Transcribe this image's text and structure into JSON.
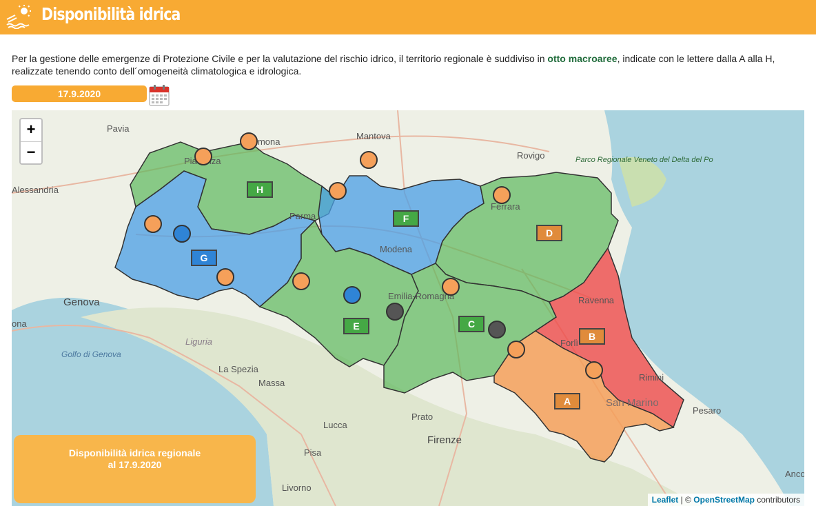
{
  "header": {
    "title": "Disponibilità idrica",
    "logo_icon": "water-sun-logo-icon"
  },
  "intro": {
    "text_before": "Per la gestione delle emergenze di Protezione Civile e per la valutazione del rischio idrico, il territorio regionale è suddiviso in ",
    "highlight": "otto macroaree",
    "text_after": ", indicate con le lettere dalla A alla H, realizzate tenendo conto dell´omogeneità climatologica e idrologica."
  },
  "date": {
    "value": "17.9.2020",
    "calendar_icon": "calendar-icon"
  },
  "map": {
    "zoom_in": "+",
    "zoom_out": "−",
    "panel_line1": "Disponibilità idrica regionale",
    "panel_line2": "al 17.9.2020",
    "attribution": {
      "leaflet": "Leaflet",
      "sep": " | © ",
      "osm": "OpenStreetMap",
      "suffix": " contributors"
    },
    "colors": {
      "green": "#5cb85c",
      "blue": "#4a9fe6",
      "orange": "#f5a05a",
      "red": "#ee4b4b",
      "dark": "#555555"
    },
    "zones": [
      {
        "letter": "H",
        "status": "green"
      },
      {
        "letter": "G",
        "status": "blue"
      },
      {
        "letter": "F",
        "status": "green"
      },
      {
        "letter": "E",
        "status": "green"
      },
      {
        "letter": "D",
        "status": "orange"
      },
      {
        "letter": "C",
        "status": "green"
      },
      {
        "letter": "B",
        "status": "orange"
      },
      {
        "letter": "A",
        "status": "orange"
      }
    ],
    "places": {
      "pavia": "Pavia",
      "cremona": "Cremona",
      "mantova": "Mantova",
      "rovigo": "Rovigo",
      "piacenza": "Piacenza",
      "alessandria": "Alessandria",
      "parma": "Parma",
      "ferrara": "Ferrara",
      "modena": "Modena",
      "emilia": "Emilia-Romagna",
      "genova": "Genova",
      "liguria": "Liguria",
      "golfo": "Golfo di Genova",
      "laspezia": "La Spezia",
      "massa": "Massa",
      "ravenna": "Ravenna",
      "forli": "Forlì",
      "rimini": "Rimini",
      "sanmarino": "San Marino",
      "pesaro": "Pesaro",
      "prato": "Prato",
      "firenze": "Firenze",
      "lucca": "Lucca",
      "pisa": "Pisa",
      "livorno": "Livorno",
      "ancona": "Anco",
      "ona": "ona",
      "parco": "Parco Regionale Veneto del Delta del Po"
    }
  }
}
